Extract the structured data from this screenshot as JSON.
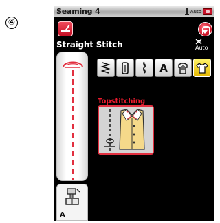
{
  "step_marker": "④",
  "status_bar": {
    "title": "Seaming 4",
    "auto_label": "Auto",
    "needle_icon": "needle-position-icon",
    "bobbin_icon": "bobbin-icon"
  },
  "stitch": {
    "icon": "stitch-edit-icon",
    "name": "Straight Stitch",
    "reverse_icon": "reverse-stitch-icon",
    "tension_label": "Auto",
    "tension_icon": "thread-tension-icon"
  },
  "preview": {
    "presser_foot_icon": "presser-foot-icon",
    "foot_letter": "A",
    "seam_color": "#e23040"
  },
  "categories": [
    {
      "name": "utility-stitches",
      "icon": "zigzag-stitch-icon",
      "selected": false
    },
    {
      "name": "buttonhole-stitches",
      "icon": "buttonhole-icon",
      "selected": false
    },
    {
      "name": "decorative-stitches",
      "icon": "decorative-stitch-icon",
      "selected": false
    },
    {
      "name": "alphabet",
      "icon": "alphabet-icon",
      "label": "A",
      "selected": false
    },
    {
      "name": "quilting",
      "icon": "hand-garment-icon",
      "selected": false
    },
    {
      "name": "garment-sewing",
      "icon": "shirt-icon",
      "selected": true
    }
  ],
  "technique_tile": {
    "label": "Topstitching",
    "icon": "topstitching-shirt-icon"
  },
  "colors": {
    "accent_red": "#e23040",
    "selected_yellow": "#f0d020",
    "screen_bg": "#000000"
  }
}
